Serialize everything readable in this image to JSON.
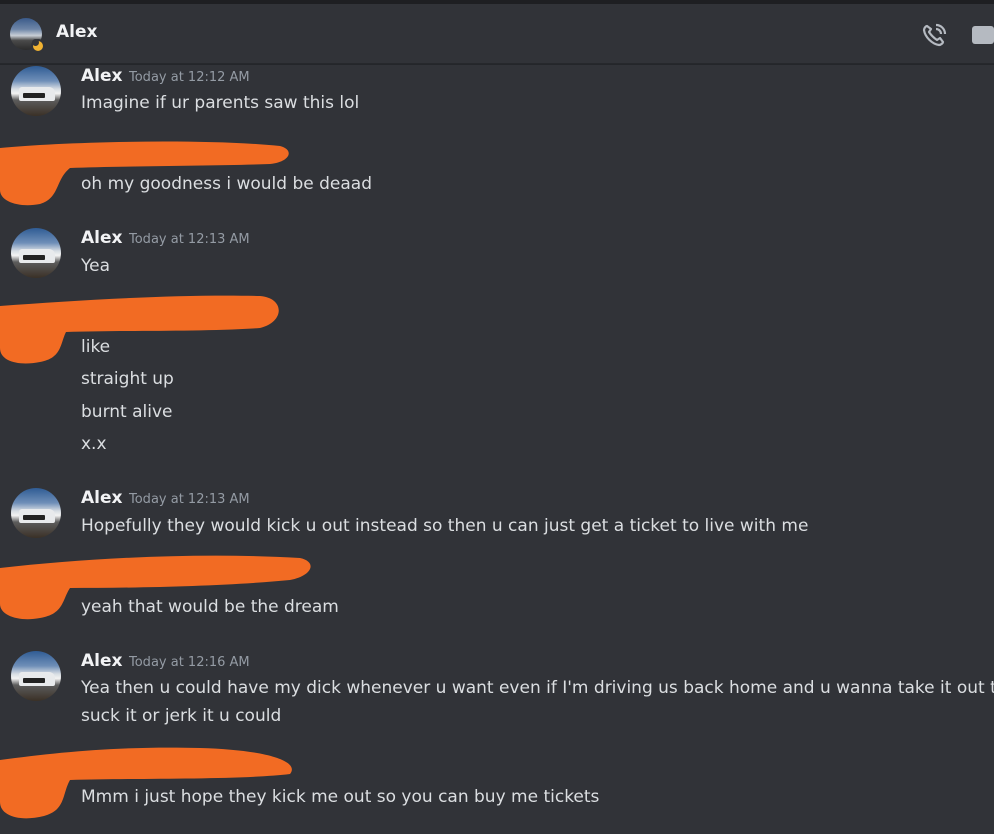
{
  "header": {
    "title": "Alex",
    "status": "idle"
  },
  "colors": {
    "background": "#313338",
    "text": "#dbdee1",
    "username": "#f2f3f5",
    "timestamp": "#949ba4",
    "redaction": "#f26b23",
    "idle_status": "#f0b232"
  },
  "icons": {
    "call": "phone-call-icon",
    "video": "video-camera-icon"
  },
  "messages": [
    {
      "author": "Alex",
      "timestamp": "Today at 12:12 AM",
      "lines": [
        "Imagine if ur parents saw this lol"
      ]
    },
    {
      "author": "",
      "redacted": true,
      "lines": [
        "oh my goodness i would be deaad"
      ]
    },
    {
      "author": "Alex",
      "timestamp": "Today at 12:13 AM",
      "lines": [
        "Yea"
      ]
    },
    {
      "author": "",
      "redacted": true,
      "lines": [
        "like",
        "straight up",
        "burnt alive",
        "x.x"
      ]
    },
    {
      "author": "Alex",
      "timestamp": "Today at 12:13 AM",
      "lines": [
        "Hopefully they would kick u out instead so then u can just get a ticket to live with me"
      ]
    },
    {
      "author": "",
      "redacted": true,
      "lines": [
        "yeah that would be the dream"
      ]
    },
    {
      "author": "Alex",
      "timestamp": "Today at 12:16 AM",
      "lines": [
        "Yea then u could have my dick whenever u want even if I'm driving us back home and u wanna take it out to",
        "suck it or jerk it u could"
      ]
    },
    {
      "author": "",
      "redacted": true,
      "lines": [
        "Mmm i just hope they kick me out so you can buy me tickets"
      ]
    }
  ]
}
